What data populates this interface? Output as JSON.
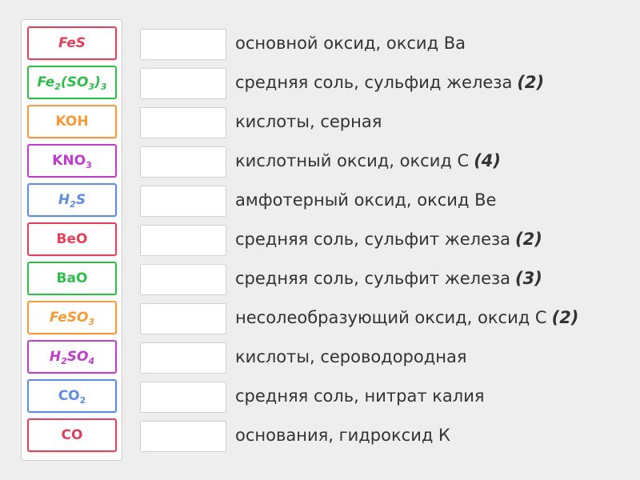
{
  "tiles": [
    {
      "name": "tile-fes",
      "color": "#e0405a",
      "italic": true,
      "parts": [
        [
          "FeS",
          ""
        ]
      ]
    },
    {
      "name": "tile-fe2so33",
      "color": "#2fbd4a",
      "italic": true,
      "parts": [
        [
          "Fe",
          "2"
        ],
        [
          "(SO",
          "3"
        ],
        [
          ")",
          "3"
        ]
      ]
    },
    {
      "name": "tile-koh",
      "color": "#f59a35",
      "italic": false,
      "parts": [
        [
          "KOH",
          ""
        ]
      ]
    },
    {
      "name": "tile-kno3",
      "color": "#c03ccf",
      "italic": false,
      "parts": [
        [
          "KNO",
          "3"
        ]
      ]
    },
    {
      "name": "tile-h2s",
      "color": "#5b8ee2",
      "italic": true,
      "parts": [
        [
          "H",
          "2"
        ],
        [
          "S",
          ""
        ]
      ]
    },
    {
      "name": "tile-beo",
      "color": "#e0405a",
      "italic": false,
      "parts": [
        [
          "BeO",
          ""
        ]
      ]
    },
    {
      "name": "tile-bao",
      "color": "#2fbd4a",
      "italic": false,
      "parts": [
        [
          "BaO",
          ""
        ]
      ]
    },
    {
      "name": "tile-feso3",
      "color": "#f59a35",
      "italic": true,
      "parts": [
        [
          "FeSO",
          "3"
        ]
      ]
    },
    {
      "name": "tile-h2so4",
      "color": "#c03ccf",
      "italic": true,
      "parts": [
        [
          "H",
          "2"
        ],
        [
          "SO",
          "4"
        ]
      ]
    },
    {
      "name": "tile-co2",
      "color": "#5b8ee2",
      "italic": false,
      "parts": [
        [
          "CO",
          "2"
        ]
      ]
    },
    {
      "name": "tile-co",
      "color": "#e0405a",
      "italic": false,
      "parts": [
        [
          "CO",
          ""
        ]
      ]
    }
  ],
  "labels": [
    {
      "text": "основной оксид, оксид Ba",
      "suffix": ""
    },
    {
      "text": "средняя соль, сульфид железа",
      "suffix": "(2)"
    },
    {
      "text": "кислоты, серная",
      "suffix": ""
    },
    {
      "text": "кислотный оксид, оксид С",
      "suffix": "(4)"
    },
    {
      "text": "амфотерный оксид, оксид Be",
      "suffix": ""
    },
    {
      "text": "средняя соль, сульфит железа",
      "suffix": "(2)"
    },
    {
      "text": "средняя соль, сульфит железа",
      "suffix": "(3)"
    },
    {
      "text": "несолеобразующий оксид, оксид С",
      "suffix": "(2)"
    },
    {
      "text": "кислоты, сероводородная",
      "suffix": ""
    },
    {
      "text": "средняя соль, нитрат калия",
      "suffix": ""
    },
    {
      "text": "основания, гидроксид К",
      "suffix": ""
    }
  ]
}
